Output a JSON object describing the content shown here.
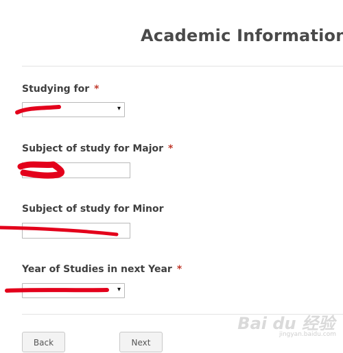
{
  "page": {
    "title": "Academic Information"
  },
  "fields": {
    "studying_for": {
      "label": "Studying for",
      "required_mark": "*",
      "arrow": "▾"
    },
    "major": {
      "label": "Subject of study for Major",
      "required_mark": "*"
    },
    "minor": {
      "label": "Subject of study for Minor"
    },
    "year": {
      "label": "Year of Studies in next Year",
      "required_mark": "*",
      "arrow": "▾"
    }
  },
  "buttons": {
    "back_label": "Back",
    "next_label": "Next"
  },
  "watermark": {
    "logo_text": "Bai du 经验",
    "url": "jingyan.baidu.com"
  },
  "colors": {
    "required": "#c0392b",
    "redaction": "#e3001b"
  }
}
